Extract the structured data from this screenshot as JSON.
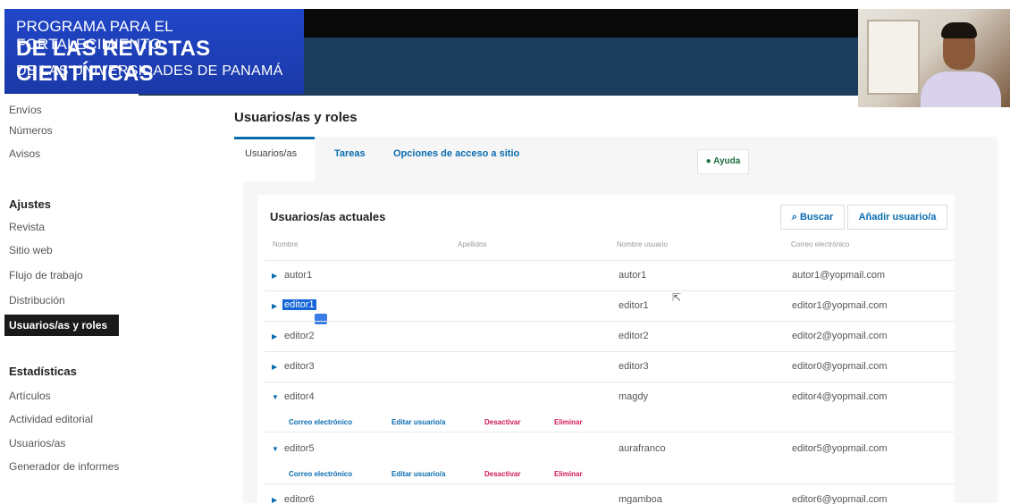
{
  "header": {
    "logo_line1": "PROGRAMA PARA EL FORTALECIMIENTO",
    "logo_line2": "DE LAS REVISTAS CIENTÍFICAS",
    "logo_line3": "DE LAS UNIVERSIDADES DE PANAMÁ"
  },
  "sidebar": {
    "top_items": [
      "Envíos",
      "Números",
      "Avisos"
    ],
    "settings_heading": "Ajustes",
    "settings_items": [
      "Revista",
      "Sitio web",
      "Flujo de trabajo",
      "Distribución",
      "Usuarios/as y roles"
    ],
    "stats_heading": "Estadísticas",
    "stats_items": [
      "Artículos",
      "Actividad editorial",
      "Usuarios/as",
      "Generador de informes"
    ]
  },
  "main": {
    "title": "Usuarios/as y roles",
    "tabs": [
      "Usuarios/as",
      "Tareas",
      "Opciones de acceso a sitio"
    ],
    "help_label": "Ayuda",
    "grid_title": "Usuarios/as actuales",
    "search_label": "Buscar",
    "add_user_label": "Añadir usuario/a",
    "columns": [
      "Nombre",
      "Apellidos",
      "Nombre usuario",
      "Correo electrónico"
    ],
    "rows": [
      {
        "name": "autor1",
        "username": "autor1",
        "email": "autor1@yopmail.com"
      },
      {
        "name": "editor1",
        "username": "editor1",
        "email": "editor1@yopmail.com"
      },
      {
        "name": "editor2",
        "username": "editor2",
        "email": "editor2@yopmail.com"
      },
      {
        "name": "editor3",
        "username": "editor3",
        "email": "editor0@yopmail.com"
      },
      {
        "name": "editor4",
        "username": "magdy",
        "email": "editor4@yopmail.com"
      },
      {
        "name": "editor5",
        "username": "aurafranco",
        "email": "editor5@yopmail.com"
      },
      {
        "name": "editor6",
        "username": "mgamboa",
        "email": "editor6@yopmail.com"
      }
    ],
    "row_actions": [
      "Correo electrónico",
      "Editar usuario/a",
      "Desactivar",
      "Eliminar"
    ]
  },
  "colors": {
    "accent": "#0a6bb0",
    "danger": "#d0195b",
    "help": "#1c6d3f"
  }
}
